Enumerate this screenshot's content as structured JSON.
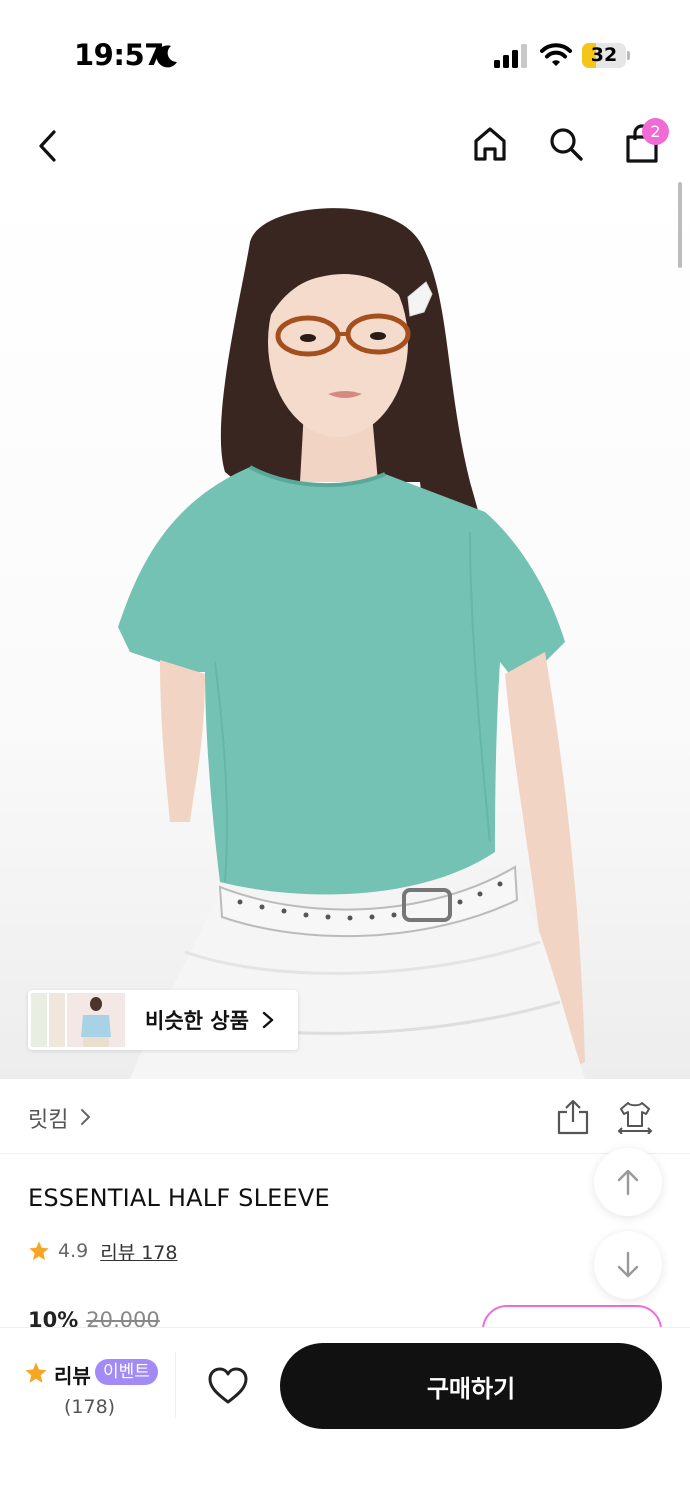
{
  "status_bar": {
    "time": "19:57",
    "battery_percent": "32",
    "battery_level": 0.32,
    "battery_color": "#f5c518"
  },
  "nav": {
    "cart_count": "2",
    "badge_color": "#f06bd6",
    "icons": [
      "back-icon",
      "home-icon",
      "search-icon",
      "shopping-bag-icon"
    ]
  },
  "hero": {
    "similar_products_label": "비슷한 상품"
  },
  "product": {
    "brand": "릿킴",
    "name": "ESSENTIAL HALF SLEEVE",
    "rating": "4.9",
    "review_link": "리뷰 178",
    "discount": "10%",
    "original_price": "20,000"
  },
  "bottom_bar": {
    "review_label": "리뷰",
    "event_badge": "이벤트",
    "review_count": "(178)",
    "buy_label": "구매하기",
    "event_color": "#a28bf7",
    "buy_color": "#111111"
  }
}
